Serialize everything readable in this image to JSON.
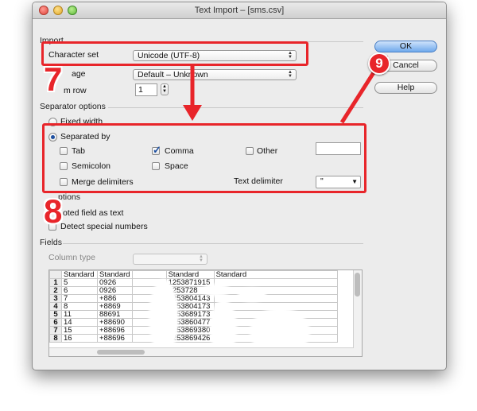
{
  "window": {
    "title": "Text Import – [sms.csv]"
  },
  "import": {
    "section_label": "Import",
    "character_set_label": "Character set",
    "character_set_value": "Unicode (UTF-8)",
    "language_label": "age",
    "language_value": "Default – Unknown",
    "from_row_label": "m row",
    "from_row_value": "1"
  },
  "buttons": {
    "ok": "OK",
    "cancel": "Cancel",
    "help": "Help"
  },
  "separator": {
    "section_label": "Separator options",
    "fixed_width": "Fixed width",
    "separated_by": "Separated by",
    "tab": "Tab",
    "comma": "Comma",
    "other": "Other",
    "semicolon": "Semicolon",
    "space": "Space",
    "merge_delimiters": "Merge delimiters",
    "text_delimiter_label": "Text delimiter",
    "text_delimiter_value": "\"",
    "selected_mode": "separated_by",
    "checked": [
      "comma"
    ]
  },
  "other_options": {
    "section_label": "ptions",
    "quoted_field": "oted field as text",
    "detect_special": "Detect special numbers"
  },
  "fields": {
    "section_label": "Fields",
    "column_type_label": "Column type",
    "column_type_value": "",
    "headers": [
      "Standard",
      "Standard",
      "",
      "Standard",
      "Standard"
    ],
    "rows": [
      {
        "n": "1",
        "cells": [
          "5",
          "0926",
          "",
          "1253871915",
          ""
        ]
      },
      {
        "n": "2",
        "cells": [
          "6",
          "0926",
          "",
          "1253728",
          ""
        ]
      },
      {
        "n": "3",
        "cells": [
          "7",
          "+886",
          "",
          "1253804143",
          ""
        ]
      },
      {
        "n": "4",
        "cells": [
          "8",
          "+8869",
          "",
          "1253804173",
          ""
        ]
      },
      {
        "n": "5",
        "cells": [
          "11",
          "88691",
          "",
          "1253689173",
          ""
        ]
      },
      {
        "n": "6",
        "cells": [
          "14",
          "+88690",
          "",
          "1253860477",
          ""
        ]
      },
      {
        "n": "7",
        "cells": [
          "15",
          "+88696",
          "",
          "1253869380",
          ""
        ]
      },
      {
        "n": "8",
        "cells": [
          "16",
          "+88696",
          "",
          "1253869426",
          ""
        ]
      }
    ]
  },
  "annotations": {
    "step_7": "7",
    "step_8": "8",
    "step_9": "9",
    "accent": "#e8252a"
  }
}
